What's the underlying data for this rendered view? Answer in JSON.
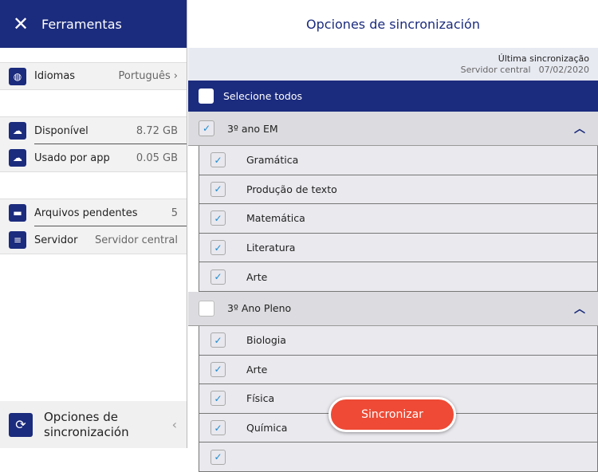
{
  "sidebar": {
    "title": "Ferramentas",
    "language": {
      "label": "Idiomas",
      "value": "Português"
    },
    "available": {
      "label": "Disponível",
      "value": "8.72 GB"
    },
    "used": {
      "label": "Usado por app",
      "value": "0.05 GB"
    },
    "pending": {
      "label": "Arquivos pendentes",
      "value": "5"
    },
    "server": {
      "label": "Servidor",
      "value": "Servidor central"
    },
    "footer": {
      "label": "Opciones de sincronización"
    }
  },
  "main": {
    "title": "Opciones de sincronización",
    "last_sync": {
      "label": "Última sincronização",
      "server": "Servidor central",
      "date": "07/02/2020"
    },
    "select_all": "Selecione todos",
    "groups": [
      {
        "name": "3º ano EM",
        "checked": true,
        "items": [
          "Gramática",
          "Produção de texto",
          "Matemática",
          "Literatura",
          "Arte"
        ]
      },
      {
        "name": "3º Ano Pleno",
        "checked": false,
        "items": [
          "Biologia",
          "Arte",
          "Física",
          "Química",
          ""
        ]
      }
    ],
    "sync_button": "Sincronizar"
  },
  "colors": {
    "navy": "#1b2b7d",
    "accent": "#ee4a35"
  }
}
